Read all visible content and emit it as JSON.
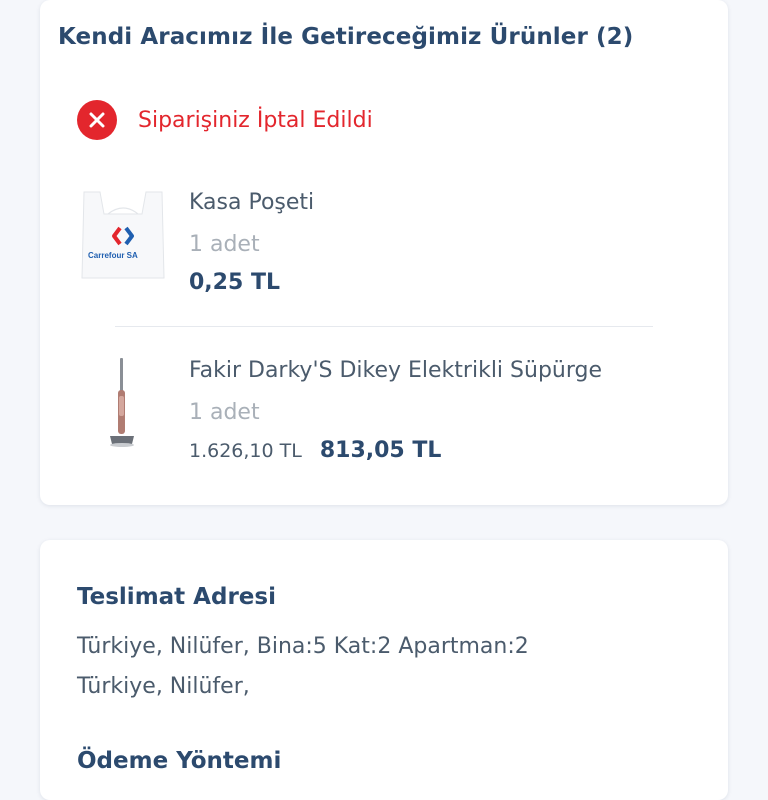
{
  "products_card": {
    "title": "Kendi Aracımız İle Getireceğimiz Ürünler (2)",
    "status": {
      "text": "Siparişiniz İptal Edildi",
      "icon": "close-circle-icon",
      "color": "#e3262d"
    },
    "items": [
      {
        "name": "Kasa Poşeti",
        "quantity": "1 adet",
        "old_price": "",
        "price": "0,25 TL",
        "image": "carrier-bag-image",
        "brand_mark": "Carrefour SA"
      },
      {
        "name": "Fakir Darky'S Dikey Elektrikli Süpürge",
        "quantity": "1 adet",
        "old_price": "1.626,10 TL",
        "price": "813,05 TL",
        "image": "stick-vacuum-image"
      }
    ]
  },
  "address_card": {
    "title": "Teslimat Adresi",
    "lines": [
      "Türkiye, Nilüfer,  Bina:5 Kat:2 Apartman:2",
      "Türkiye, Nilüfer,"
    ],
    "payment_title": "Ödeme Yöntemi"
  },
  "colors": {
    "accent": "#2c4a6e",
    "error": "#e3262d",
    "muted": "#a9b0b8",
    "background": "#f5f7fb"
  }
}
